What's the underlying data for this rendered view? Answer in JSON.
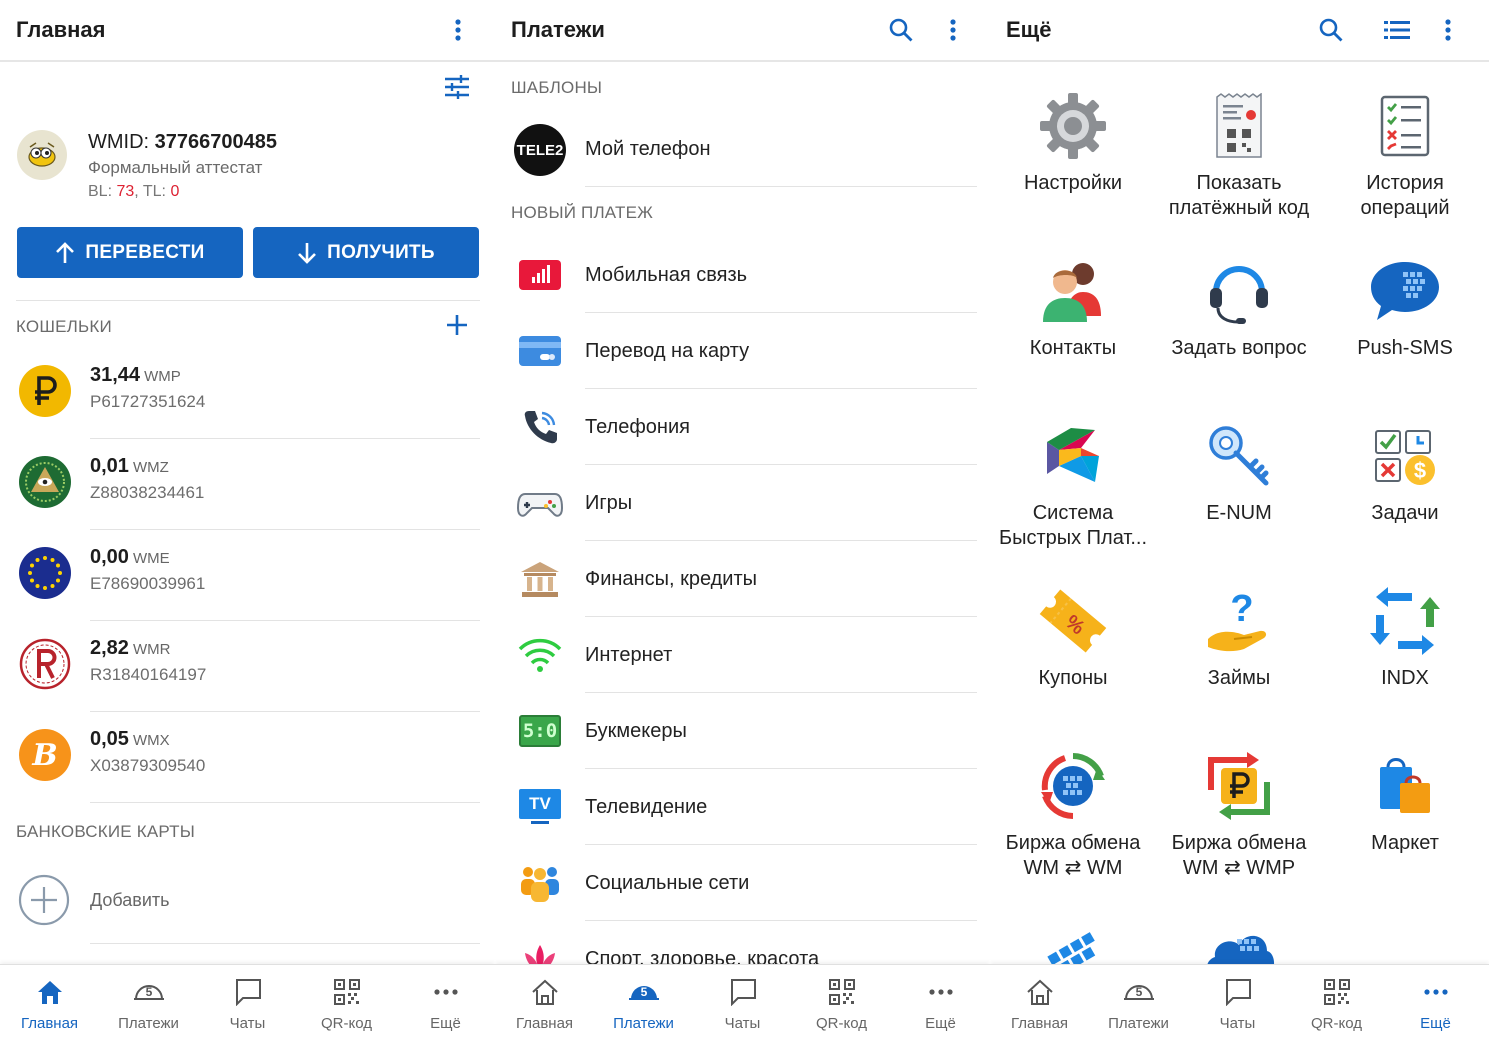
{
  "home": {
    "title": "Главная",
    "wmid_label": "WMID:",
    "wmid_value": "37766700485",
    "attestat": "Формальный аттестат",
    "bl_label": "BL:",
    "bl_value": "73",
    "tl_label": "TL:",
    "tl_value": "0",
    "transfer_btn": "ПЕРЕВЕСТИ",
    "receive_btn": "ПОЛУЧИТЬ",
    "wallets_label": "КОШЕЛЬКИ",
    "wallets": [
      {
        "amount": "31,44",
        "currency": "WMP",
        "number": "P61727351624",
        "color": "#f2b800"
      },
      {
        "amount": "0,01",
        "currency": "WMZ",
        "number": "Z88038234461",
        "color": "#1e6b33"
      },
      {
        "amount": "0,00",
        "currency": "WME",
        "number": "E78690039961",
        "color": "#1b2d8f"
      },
      {
        "amount": "2,82",
        "currency": "WMR",
        "number": "R31840164197",
        "color": "#b8232c"
      },
      {
        "amount": "0,05",
        "currency": "WMX",
        "number": "X03879309540",
        "color": "#f7931a"
      }
    ],
    "bank_cards_label": "БАНКОВСКИЕ КАРТЫ",
    "add_label": "Добавить"
  },
  "payments": {
    "title": "Платежи",
    "templates_label": "ШАБЛОНЫ",
    "template_item": "Мой телефон",
    "template_logo": "TELE2",
    "new_payment_label": "НОВЫЙ ПЛАТЕЖ",
    "items": [
      {
        "label": "Мобильная связь",
        "icon": "mobile-signal-icon"
      },
      {
        "label": "Перевод на карту",
        "icon": "card-icon"
      },
      {
        "label": "Телефония",
        "icon": "phone-icon"
      },
      {
        "label": "Игры",
        "icon": "gamepad-icon"
      },
      {
        "label": "Финансы, кредиты",
        "icon": "bank-icon"
      },
      {
        "label": "Интернет",
        "icon": "wifi-icon"
      },
      {
        "label": "Букмекеры",
        "icon": "scoreboard-icon"
      },
      {
        "label": "Телевидение",
        "icon": "tv-icon"
      },
      {
        "label": "Социальные сети",
        "icon": "people-icon"
      },
      {
        "label": "Спорт, здоровье, красота",
        "icon": "lotus-icon"
      }
    ],
    "scoreboard_text": "5:0",
    "tv_text": "TV"
  },
  "more": {
    "title": "Ещё",
    "tiles": [
      {
        "label": "Настройки",
        "icon": "gear-icon"
      },
      {
        "label": "Показать платёжный код",
        "icon": "receipt-qr-icon"
      },
      {
        "label": "История операций",
        "icon": "checklist-icon"
      },
      {
        "label": "Контакты",
        "icon": "contacts-icon"
      },
      {
        "label": "Задать вопрос",
        "icon": "headset-icon"
      },
      {
        "label": "Push-SMS",
        "icon": "chat-bubble-icon"
      },
      {
        "label": "Система Быстрых Плат...",
        "icon": "sbp-icon"
      },
      {
        "label": "E-NUM",
        "icon": "key-icon"
      },
      {
        "label": "Задачи",
        "icon": "tasks-icon"
      },
      {
        "label": "Купоны",
        "icon": "coupon-icon"
      },
      {
        "label": "Займы",
        "icon": "loan-icon"
      },
      {
        "label": "INDX",
        "icon": "exchange-arrows-icon"
      },
      {
        "label": "Биржа обмена WM ⇄ WM",
        "icon": "exchange-wm-icon"
      },
      {
        "label": "Биржа обмена WM ⇄ WMP",
        "icon": "exchange-wmp-icon"
      },
      {
        "label": "Маркет",
        "icon": "shopping-bag-icon"
      }
    ]
  },
  "nav": {
    "home": "Главная",
    "payments": "Платежи",
    "chats": "Чаты",
    "qr": "QR-код",
    "more": "Ещё",
    "payments_badge": "5"
  },
  "colors": {
    "accent": "#1565c0",
    "red": "#dd2233"
  }
}
